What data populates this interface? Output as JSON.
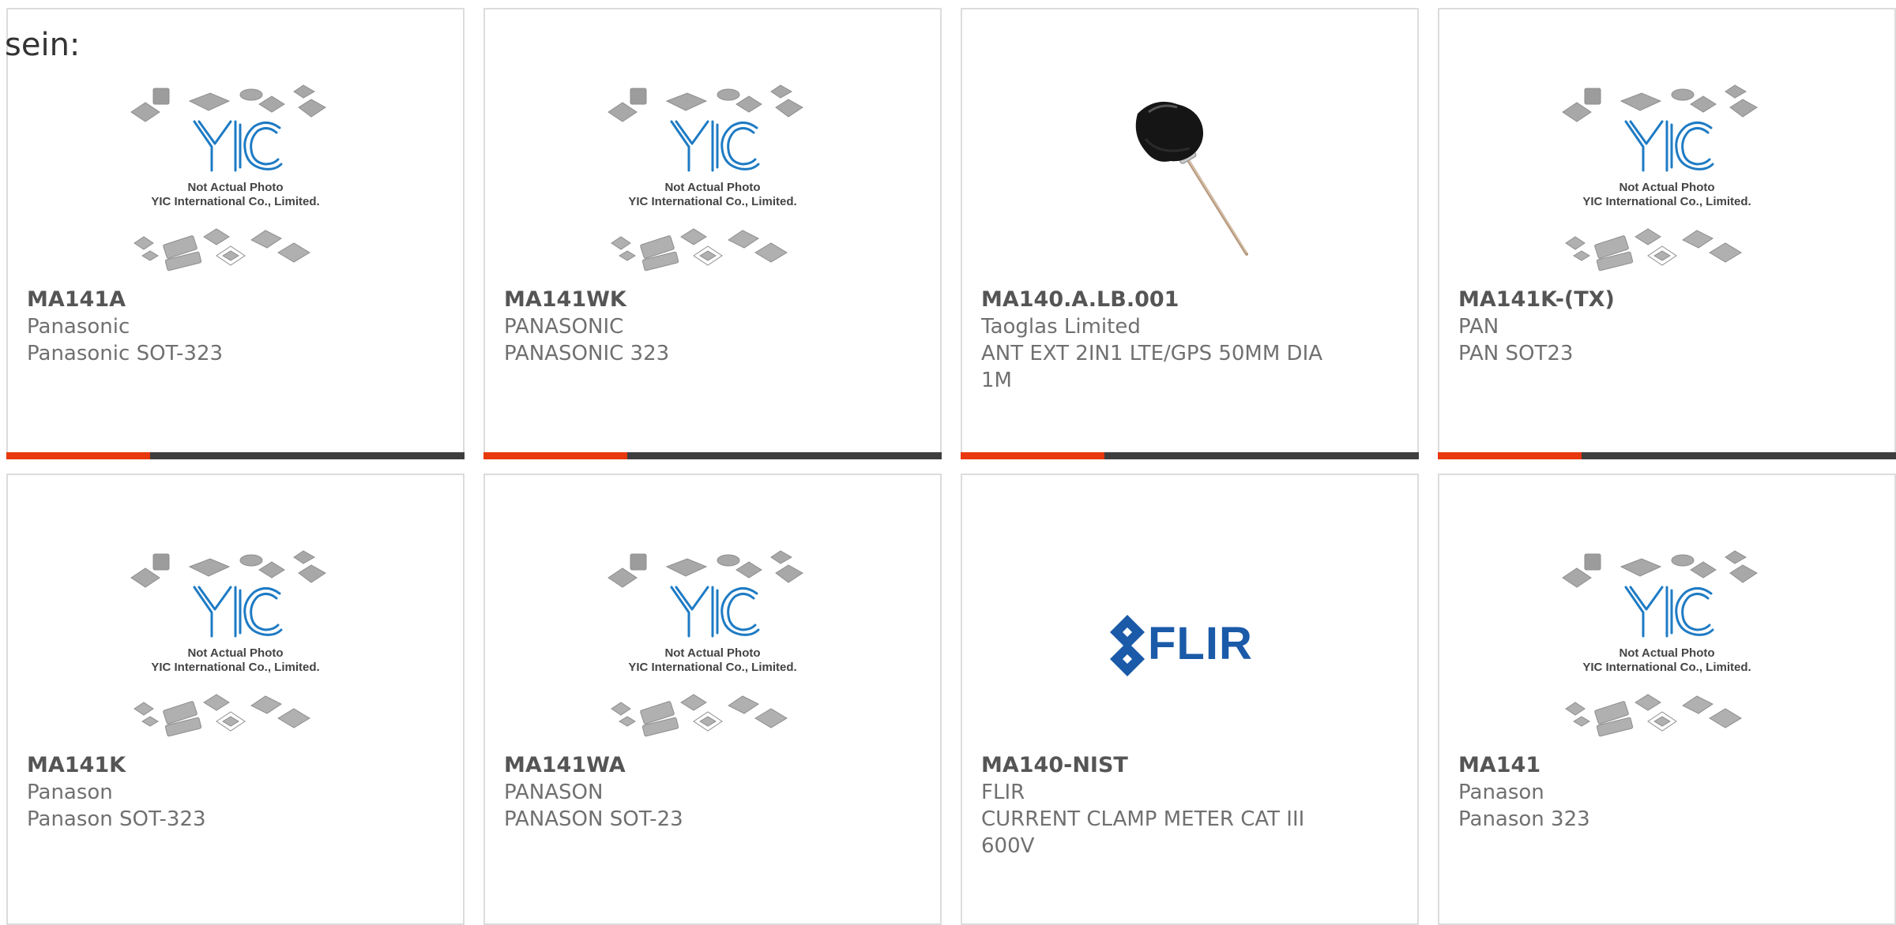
{
  "header": {
    "lead_text": "sein:"
  },
  "placeholder": {
    "logo_text": "YIC",
    "caption_line1": "Not Actual Photo",
    "caption_line2": "YIC International Co., Limited."
  },
  "colors": {
    "accent_bar": "#e8380d",
    "bar_dark": "#3e3e3e",
    "card_border": "#dcdcdc",
    "yic_blue": "#1e7bc4",
    "flir_blue": "#1a5aa8"
  },
  "products": [
    {
      "part_number": "MA141A",
      "manufacturer": "Panasonic",
      "description": "Panasonic SOT-323",
      "image": "yic-placeholder"
    },
    {
      "part_number": "MA141WK",
      "manufacturer": "PANASONIC",
      "description": "PANASONIC 323",
      "image": "yic-placeholder"
    },
    {
      "part_number": "MA140.A.LB.001",
      "manufacturer": "Taoglas Limited",
      "description": "ANT EXT 2IN1 LTE/GPS 50MM DIA 1M",
      "image": "antenna-photo"
    },
    {
      "part_number": "MA141K-(TX)",
      "manufacturer": "PAN",
      "description": "PAN SOT23",
      "image": "yic-placeholder"
    },
    {
      "part_number": "MA141K",
      "manufacturer": "Panason",
      "description": "Panason SOT-323",
      "image": "yic-placeholder"
    },
    {
      "part_number": "MA141WA",
      "manufacturer": "PANASON",
      "description": "PANASON SOT-23",
      "image": "yic-placeholder"
    },
    {
      "part_number": "MA140-NIST",
      "manufacturer": "FLIR",
      "description": "CURRENT CLAMP METER CAT III 600V",
      "image": "flir-logo",
      "logo_text": "FLIR"
    },
    {
      "part_number": "MA141",
      "manufacturer": "Panason",
      "description": "Panason 323",
      "image": "yic-placeholder"
    }
  ]
}
